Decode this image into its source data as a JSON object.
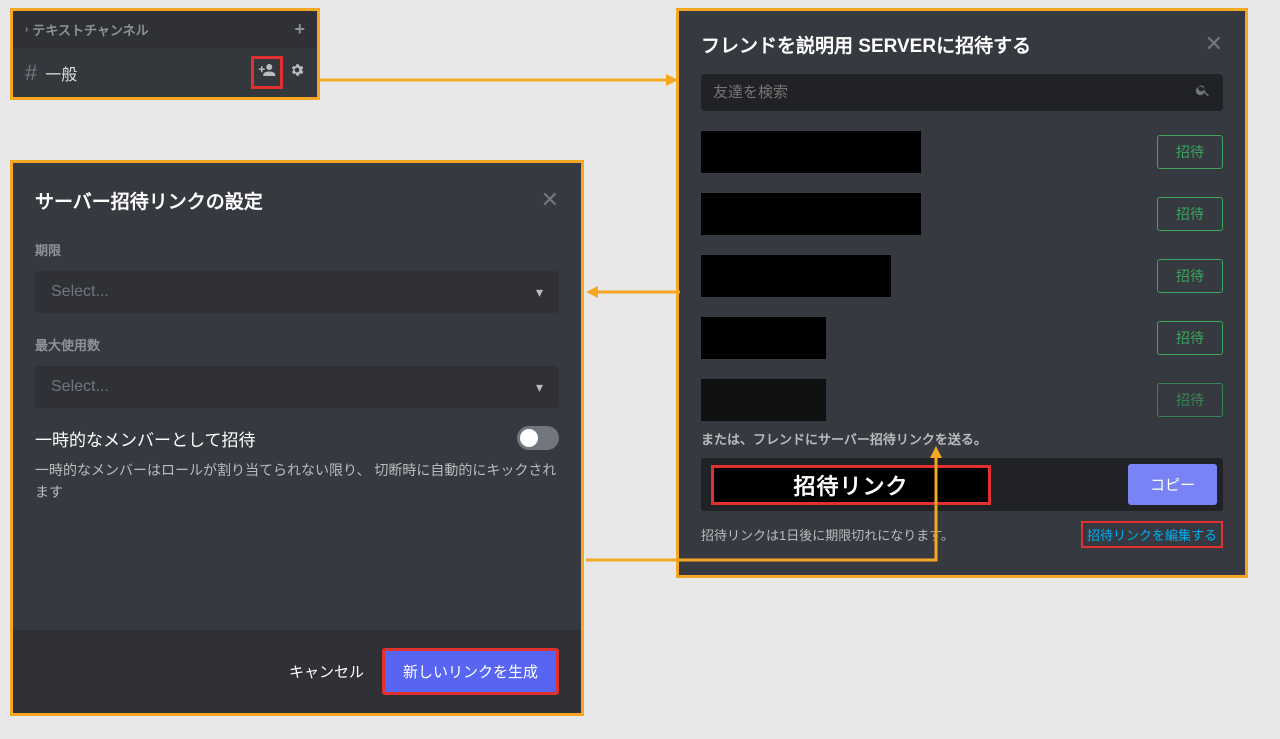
{
  "panelA": {
    "category": "テキストチャンネル",
    "channel": "一般",
    "addIconTitle": "plus",
    "inviteIconTitle": "add-person",
    "gearIconTitle": "gear"
  },
  "panelB": {
    "title": "サーバー招待リンクの設定",
    "expireLabel": "期限",
    "expirePlaceholder": "Select...",
    "usesLabel": "最大使用数",
    "usesPlaceholder": "Select...",
    "tempTitle": "一時的なメンバーとして招待",
    "tempDesc": "一時的なメンバーはロールが割り当てられない限り、 切断時に自動的にキックされます",
    "cancel": "キャンセル",
    "generate": "新しいリンクを生成"
  },
  "panelC": {
    "title": "フレンドを説明用 SERVERに招待する",
    "searchPlaceholder": "友達を検索",
    "inviteLabel": "招待",
    "friends": [
      {
        "size": "lg"
      },
      {
        "size": "lg"
      },
      {
        "size": "sm"
      },
      {
        "size": "xs"
      },
      {
        "size": "xs"
      }
    ],
    "altText": "または、フレンドにサーバー招待リンクを送る。",
    "linkLabel": "招待リンク",
    "copy": "コピー",
    "expireNote": "招待リンクは1日後に期限切れになります。",
    "editLink": "招待リンクを編集する"
  }
}
